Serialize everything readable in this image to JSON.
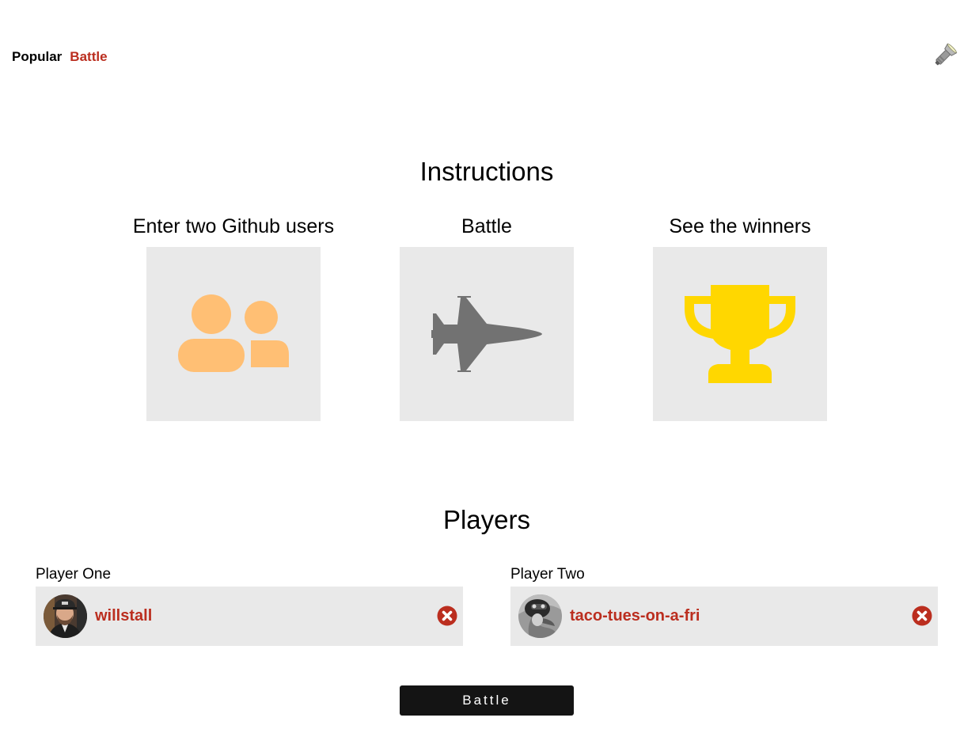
{
  "nav": {
    "items": [
      {
        "label": "Popular",
        "active": false
      },
      {
        "label": "Battle",
        "active": true
      }
    ],
    "theme_toggle_icon": "flashlight-icon"
  },
  "instructions": {
    "title": "Instructions",
    "steps": [
      {
        "label": "Enter two Github users",
        "icon": "users-icon",
        "color": "#ffbf74"
      },
      {
        "label": "Battle",
        "icon": "fighter-jet-icon",
        "color": "#727272"
      },
      {
        "label": "See the winners",
        "icon": "trophy-icon",
        "color": "#ffd700"
      }
    ]
  },
  "players": {
    "title": "Players",
    "one": {
      "label": "Player One",
      "username": "willstall"
    },
    "two": {
      "label": "Player Two",
      "username": "taco-tues-on-a-fri"
    }
  },
  "battle_button": {
    "label": "Battle"
  },
  "colors": {
    "accent": "#bb2e1f",
    "card_bg": "#e9e9e9",
    "button_bg": "#141414"
  }
}
